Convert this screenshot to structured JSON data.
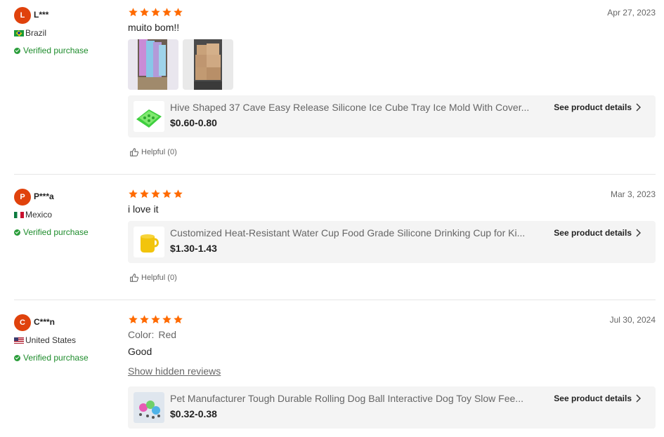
{
  "colors": {
    "star": "#ff6a00",
    "avatar": "#e0420c",
    "verified": "#1e8c2c"
  },
  "reviews": [
    {
      "avatar_letter": "L",
      "name": "L***",
      "country": "Brazil",
      "verified": "Verified purchase",
      "rating": 5,
      "date": "Apr 27, 2023",
      "text": "muito bom!!",
      "product": {
        "title": "Hive Shaped 37 Cave Easy Release Silicone Ice Cube Tray Ice Mold With Cover...",
        "price": "$0.60-0.80",
        "details_label": "See product details"
      },
      "helpful": "Helpful (0)"
    },
    {
      "avatar_letter": "P",
      "name": "P***a",
      "country": "Mexico",
      "verified": "Verified purchase",
      "rating": 5,
      "date": "Mar 3, 2023",
      "text": "i love it",
      "product": {
        "title": "Customized Heat-Resistant Water Cup Food Grade Silicone Drinking Cup for Ki...",
        "price": "$1.30-1.43",
        "details_label": "See product details"
      },
      "helpful": "Helpful (0)"
    },
    {
      "avatar_letter": "C",
      "name": "C***n",
      "country": "United States",
      "verified": "Verified purchase",
      "rating": 5,
      "date": "Jul 30, 2024",
      "color_label": "Color:",
      "color_value": "Red",
      "text": "Good",
      "hidden_link": "Show hidden reviews",
      "product": {
        "title": "Pet Manufacturer Tough Durable Rolling Dog Ball Interactive Dog Toy Slow Fee...",
        "price": "$0.32-0.38",
        "details_label": "See product details"
      }
    }
  ]
}
